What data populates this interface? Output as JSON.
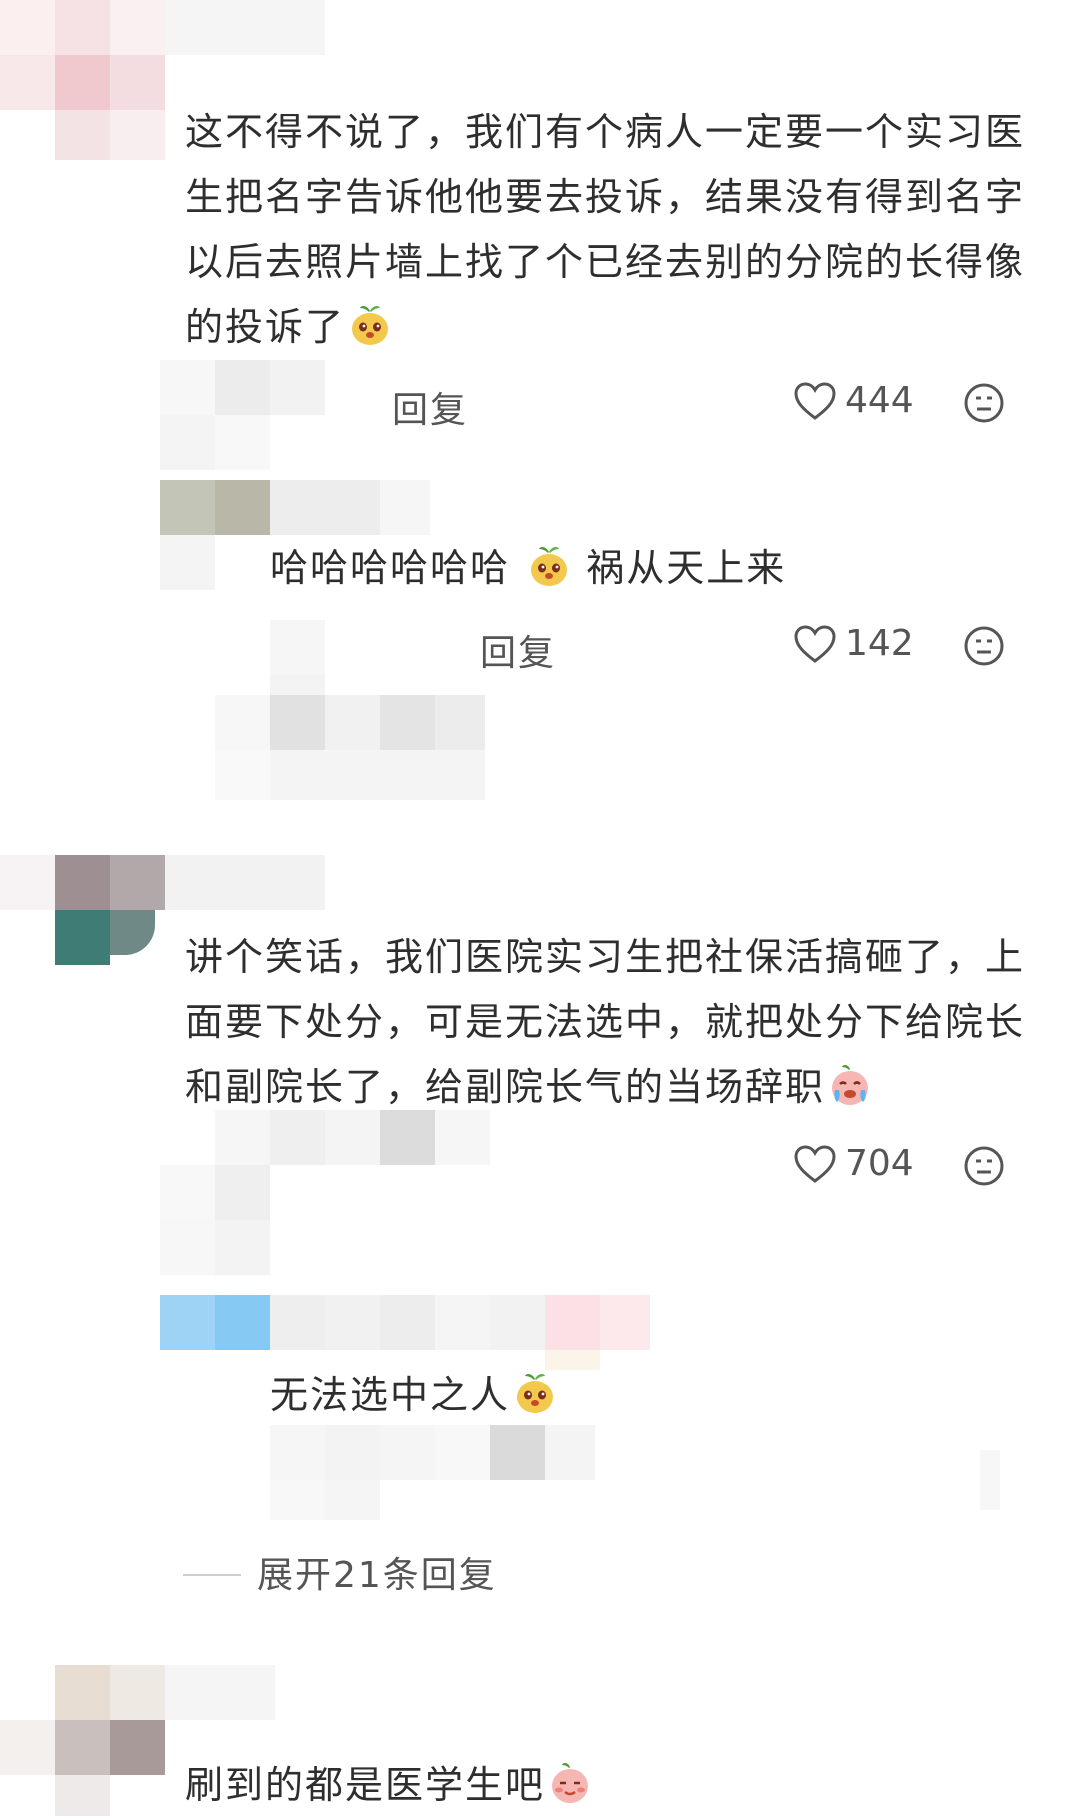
{
  "comments": [
    {
      "text": "这不得不说了，我们有个病人一定要一个实习医生把名字告诉他他要去投诉，结果没有得到名字以后去照片墙上找了个已经去别的分院的长得像的投诉了",
      "emoji": "radish-emoji",
      "reply_label": "回复",
      "likes": "444",
      "replies": [
        {
          "text_a": "哈哈哈哈哈哈",
          "text_b": "祸从天上来",
          "reply_label": "回复",
          "likes": "142"
        }
      ]
    },
    {
      "text": "讲个笑话，我们医院实习生把社保活搞砸了，上面要下处分，可是无法选中，就把处分下给院长和副院长了，给副院长气的当场辞职",
      "emoji": "crying-emoji",
      "likes": "704",
      "replies": [
        {
          "text": "无法选中之人"
        }
      ],
      "expand_label": "展开21条回复"
    },
    {
      "text": "刷到的都是医学生吧",
      "emoji": "blush-emoji"
    }
  ],
  "colors": {
    "text": "#2e2e2e",
    "muted": "#555555",
    "divider": "#cfcfcf"
  }
}
